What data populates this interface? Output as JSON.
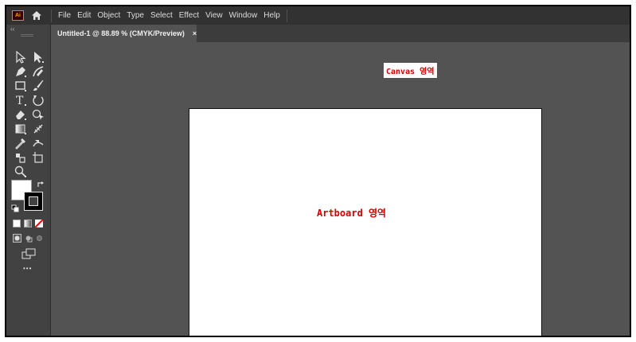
{
  "app": {
    "logo_text": "Ai",
    "logo_color": "#ff9a00"
  },
  "menubar": {
    "items": [
      "File",
      "Edit",
      "Object",
      "Type",
      "Select",
      "Effect",
      "View",
      "Window",
      "Help"
    ]
  },
  "document_tab": {
    "title": "Untitled-1 @ 88.89 % (CMYK/Preview)",
    "close_glyph": "×"
  },
  "toolbar": {
    "collapse_glyph": "‹‹",
    "more_glyph": "•••",
    "tools": [
      "selection-tool",
      "direct-selection-tool",
      "pen-tool",
      "curvature-tool",
      "rectangle-tool",
      "paintbrush-tool",
      "type-tool",
      "rotate-tool",
      "eraser-tool",
      "shape-builder-tool",
      "gradient-tool",
      "mesh-tool",
      "eyedropper-tool",
      "blend-tool",
      "live-paint-tool",
      "artboard-tool",
      "zoom-tool"
    ],
    "fill_color": "#ffffff",
    "stroke_color": "#000000"
  },
  "annotations": {
    "canvas_label": "Canvas 영역",
    "artboard_label": "Artboard 영역",
    "label_color": "#d40000"
  },
  "colors": {
    "menubar_bg": "#323232",
    "canvas_bg": "#535353",
    "toolbar_bg": "#424242",
    "artboard_bg": "#ffffff"
  }
}
